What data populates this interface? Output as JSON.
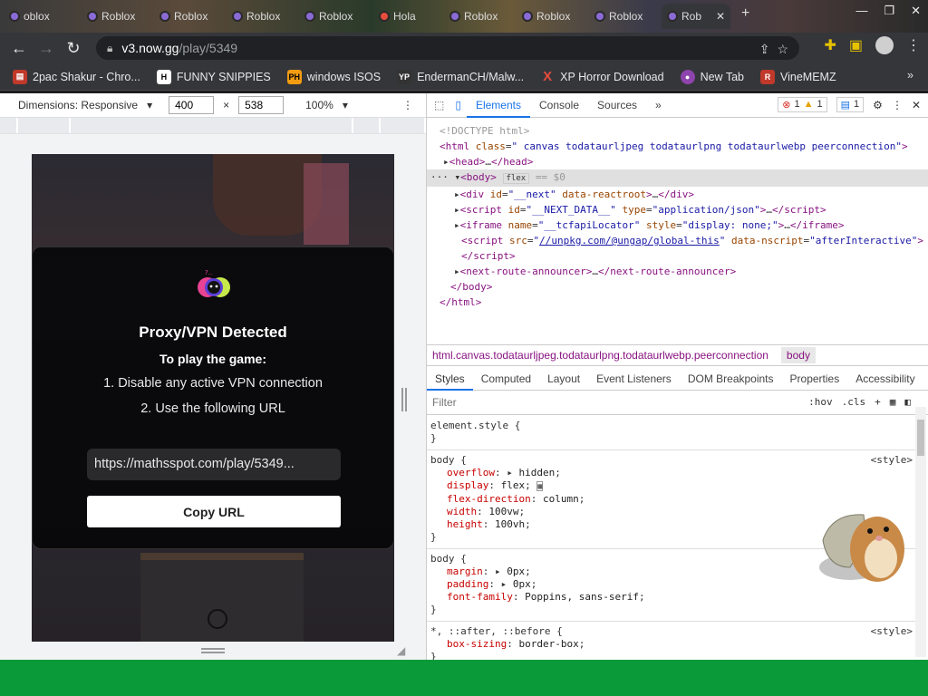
{
  "browser": {
    "tabs": [
      {
        "label": "oblox"
      },
      {
        "label": "Roblox"
      },
      {
        "label": "Roblox"
      },
      {
        "label": "Roblox"
      },
      {
        "label": "Roblox"
      },
      {
        "label": "Hola"
      },
      {
        "label": "Roblox"
      },
      {
        "label": "Roblox"
      },
      {
        "label": "Roblox"
      },
      {
        "label": "Rob"
      }
    ],
    "address": {
      "host": "v3.now.gg",
      "path": "/play/5349"
    },
    "bookmarks": [
      {
        "label": "2pac Shakur - Chro...",
        "icon": "bag-icon",
        "color": "#c0392b"
      },
      {
        "label": "FUNNY SNIPPIES",
        "icon": "h-icon",
        "color": "#ffffff"
      },
      {
        "label": "windows ISOS",
        "icon": "ph-icon",
        "color": "#f39c12"
      },
      {
        "label": "EndermanCH/Malw...",
        "icon": "yt-icon",
        "color": "#333333"
      },
      {
        "label": "XP Horror Download",
        "icon": "x-icon",
        "color": "#e74c3c"
      },
      {
        "label": "New Tab",
        "icon": "globe-icon",
        "color": "#8e44ad"
      },
      {
        "label": "VineMEMZ",
        "icon": "r-icon",
        "color": "#c0392b"
      }
    ]
  },
  "device_toolbar": {
    "dimensions_label": "Dimensions: Responsive",
    "width": "400",
    "height": "538",
    "zoom": "100%"
  },
  "page": {
    "modal": {
      "title": "Proxy/VPN Detected",
      "subtitle": "To play the game:",
      "step1": "1. Disable any active VPN connection",
      "step2": "2. Use the following URL",
      "url": "https://mathsspot.com/play/5349...",
      "copy_button": "Copy URL"
    }
  },
  "devtools": {
    "tabs": [
      "Elements",
      "Console",
      "Sources"
    ],
    "error_count": "1",
    "warning_count": "1",
    "message_count": "1",
    "breadcrumb": [
      "html.canvas.todataurljpeg.todataurlpng.todataurlwebp.peerconnection",
      "body"
    ],
    "style_tabs": [
      "Styles",
      "Computed",
      "Layout",
      "Event Listeners",
      "DOM Breakpoints",
      "Properties",
      "Accessibility"
    ],
    "filter_placeholder": "Filter",
    "hov": ":hov",
    "cls": ".cls"
  }
}
